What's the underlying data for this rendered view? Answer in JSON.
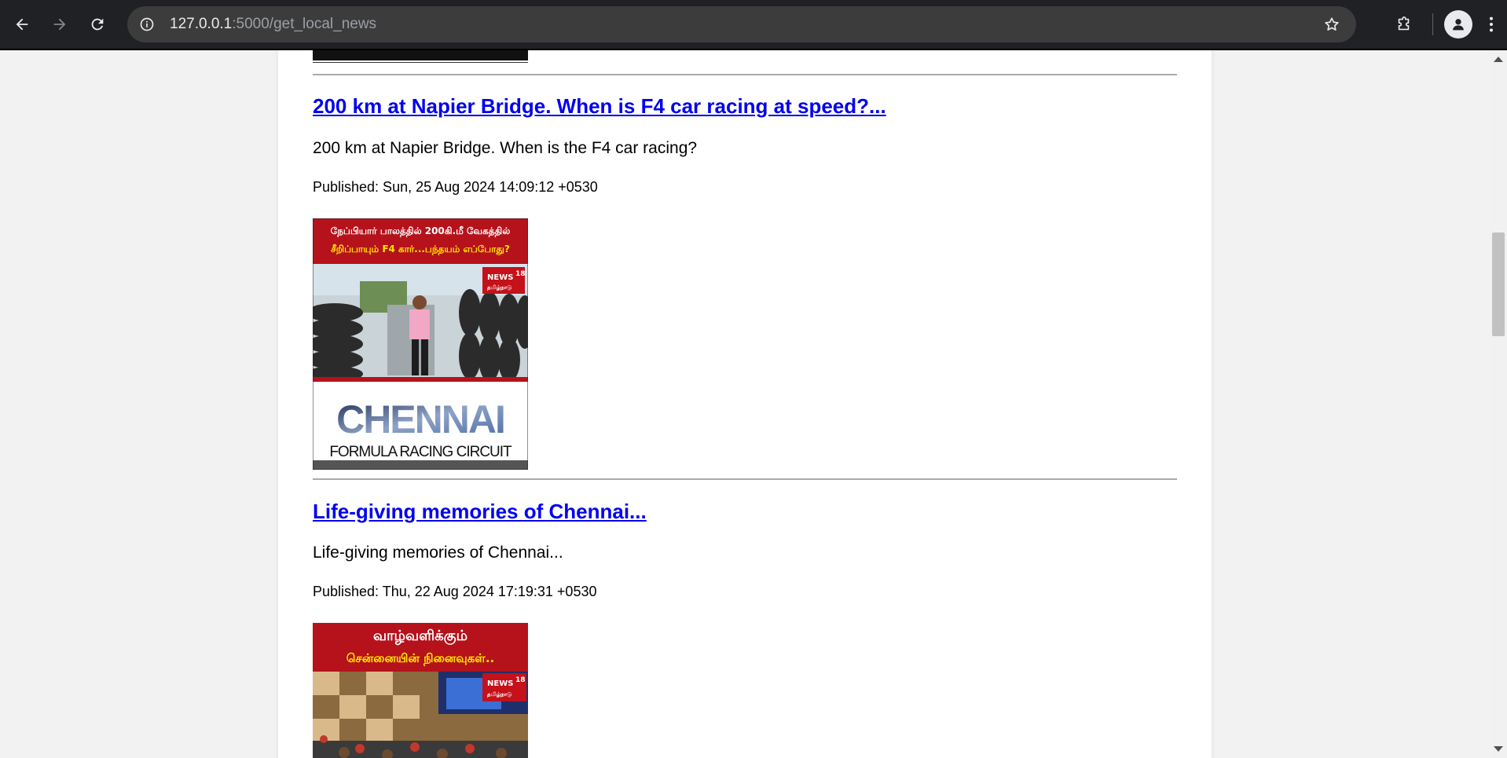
{
  "browser": {
    "url_host": "127.0.0.1",
    "url_rest": ":5000/get_local_news"
  },
  "articles": [
    {
      "title": "200 km at Napier Bridge. When is F4 car racing at speed?...",
      "summary": "200 km at Napier Bridge. When is the F4 car racing?",
      "published": "Published: Sun, 25 Aug 2024 14:09:12 +0530",
      "thumbnail": {
        "banner_line1": "நேப்பியார் பாலத்தில் 200கி.மீ வேகத்தில்",
        "banner_line2": "சீறிப்பாயும் F4 கார்...பந்தயம் எப்போது?",
        "logo_news": "NEWS",
        "logo_num": "18",
        "logo_sub": "தமிழ்நாடு",
        "wordmark": "CHENNAI",
        "wordmark_sub": "FORMULA RACING CIRCUIT"
      }
    },
    {
      "title": "Life-giving memories of Chennai...",
      "summary": "Life-giving memories of Chennai...",
      "published": "Published: Thu, 22 Aug 2024 17:19:31 +0530",
      "thumbnail": {
        "banner_line1": "வாழ்வளிக்கும்",
        "banner_line2": "சென்னையின் நினைவுகள்..",
        "logo_news": "NEWS",
        "logo_num": "18",
        "logo_sub": "தமிழ்நாடு"
      }
    }
  ],
  "colors": {
    "link": "#0000ee",
    "banner_red": "#b5121b",
    "banner_yellow": "#ffe600"
  }
}
